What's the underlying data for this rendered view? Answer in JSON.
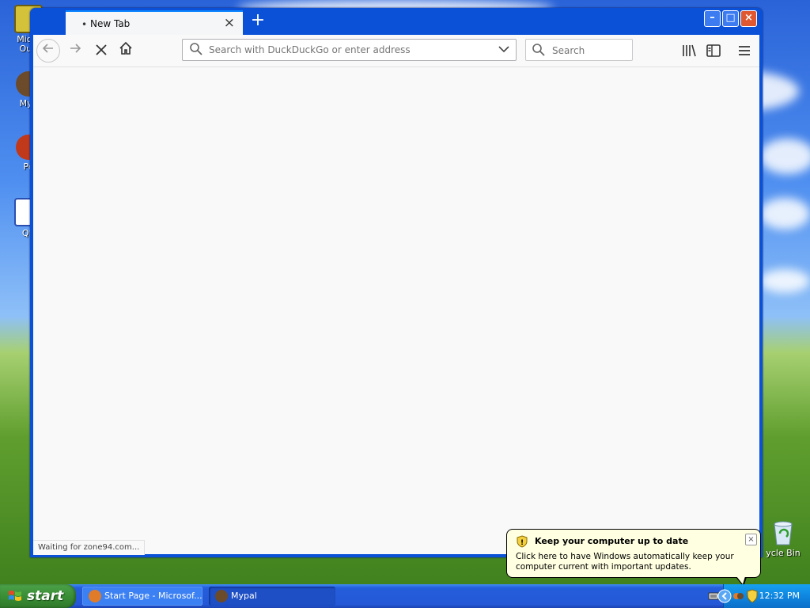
{
  "desktop": {
    "icons": [
      {
        "label": "Micro\nOutl"
      },
      {
        "label": "MyP"
      },
      {
        "label": "Pe"
      },
      {
        "label": "QR"
      }
    ],
    "recycle_bin": "ycle Bin"
  },
  "browser": {
    "tab_title": "New Tab",
    "url_placeholder": "Search with DuckDuckGo or enter address",
    "search_placeholder": "Search",
    "status": "Waiting for zone94.com..."
  },
  "taskbar": {
    "start_label": "start",
    "tasks": [
      "Start Page - Microsof...",
      "Mypal"
    ],
    "clock": "12:32 PM"
  },
  "balloon": {
    "title": "Keep your computer up to date",
    "text": "Click here to have Windows automatically keep your computer current with important updates."
  }
}
